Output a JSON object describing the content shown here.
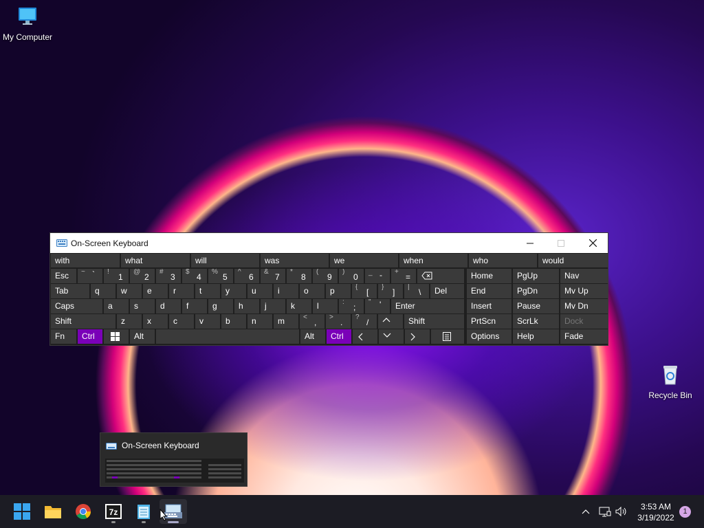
{
  "desktop": {
    "icons": [
      {
        "label": "My Computer",
        "icon": "computer-icon"
      },
      {
        "label": "Recycle Bin",
        "icon": "recycle-bin-icon"
      }
    ]
  },
  "osk": {
    "title": "On-Screen Keyboard",
    "predictions": [
      "with",
      "what",
      "will",
      "was",
      "we",
      "when",
      "who",
      "would"
    ],
    "keys": {
      "esc": "Esc",
      "tab": "Tab",
      "caps": "Caps",
      "shift": "Shift",
      "fn": "Fn",
      "ctrl": "Ctrl",
      "alt": "Alt",
      "del": "Del",
      "enter": "Enter",
      "home": "Home",
      "pgup": "PgUp",
      "nav": "Nav",
      "end": "End",
      "pgdn": "PgDn",
      "mvup": "Mv Up",
      "insert": "Insert",
      "pause": "Pause",
      "mvdn": "Mv Dn",
      "prtscn": "PrtScn",
      "scrlk": "ScrLk",
      "dock": "Dock",
      "options": "Options",
      "help": "Help",
      "fade": "Fade",
      "num_row": [
        {
          "shift": "~",
          "char": "`"
        },
        {
          "shift": "!",
          "char": "1"
        },
        {
          "shift": "@",
          "char": "2"
        },
        {
          "shift": "#",
          "char": "3"
        },
        {
          "shift": "$",
          "char": "4"
        },
        {
          "shift": "%",
          "char": "5"
        },
        {
          "shift": "^",
          "char": "6"
        },
        {
          "shift": "&",
          "char": "7"
        },
        {
          "shift": "*",
          "char": "8"
        },
        {
          "shift": "(",
          "char": "9"
        },
        {
          "shift": ")",
          "char": "0"
        },
        {
          "shift": "_",
          "char": "-"
        },
        {
          "shift": "+",
          "char": "="
        }
      ],
      "row_q": [
        "q",
        "w",
        "e",
        "r",
        "t",
        "y",
        "u",
        "i",
        "o",
        "p"
      ],
      "row_q_sym": [
        {
          "shift": "{",
          "char": "["
        },
        {
          "shift": "}",
          "char": "]"
        },
        {
          "shift": "|",
          "char": "\\"
        }
      ],
      "row_a": [
        "a",
        "s",
        "d",
        "f",
        "g",
        "h",
        "j",
        "k",
        "l"
      ],
      "row_a_sym": [
        {
          "shift": ":",
          "char": ";"
        },
        {
          "shift": "\"",
          "char": "'"
        }
      ],
      "row_z": [
        "z",
        "x",
        "c",
        "v",
        "b",
        "n",
        "m"
      ],
      "row_z_sym": [
        {
          "shift": "<",
          "char": ","
        },
        {
          "shift": ">",
          "char": "."
        },
        {
          "shift": "?",
          "char": "/"
        }
      ]
    }
  },
  "thumbnail": {
    "title": "On-Screen Keyboard"
  },
  "taskbar": {
    "apps": [
      "start-icon",
      "file-explorer-icon",
      "chrome-icon",
      "7zip-icon",
      "notepad-icon",
      "on-screen-keyboard-icon"
    ],
    "clock": {
      "time": "3:53 AM",
      "date": "3/19/2022"
    },
    "notifications": "1"
  },
  "colors": {
    "accent": "#7a00b8",
    "key": "#3a3a3a",
    "keyboard_bg": "#1f1f1f",
    "taskbar": "#1c1c24"
  }
}
